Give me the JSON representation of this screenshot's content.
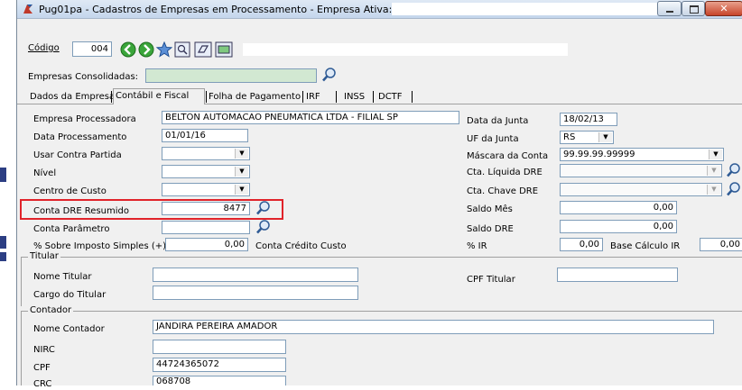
{
  "window": {
    "title": "Pug01pa - Cadastros de Empresas em Processamento - Empresa Ativa:"
  },
  "header": {
    "codigo_label": "Código",
    "codigo_value": "004",
    "consolidadas_label": "Empresas Consolidadas:",
    "consolidadas_value": ""
  },
  "tabs": [
    {
      "label": "Dados da Empresa"
    },
    {
      "label": "Contábil e Fiscal"
    },
    {
      "label": "Folha de Pagamento"
    },
    {
      "label": "IRF"
    },
    {
      "label": "INSS"
    },
    {
      "label": "DCTF"
    }
  ],
  "active_tab": "Contábil e Fiscal",
  "left_fields": {
    "empresa_processadora": {
      "label": "Empresa Processadora",
      "value": "BELTON AUTOMACAO PNEUMATICA LTDA - FILIAL SP"
    },
    "data_processamento": {
      "label": "Data Processamento",
      "value": "01/01/16"
    },
    "usar_contra_partida": {
      "label": "Usar Contra Partida",
      "value": ""
    },
    "nivel": {
      "label": "Nível",
      "value": ""
    },
    "centro_custo": {
      "label": "Centro de Custo",
      "value": ""
    },
    "conta_dre_resumido": {
      "label": "Conta DRE Resumido",
      "value": "8477"
    },
    "conta_parametro": {
      "label": "Conta Parâmetro",
      "value": ""
    },
    "sobre_imposto": {
      "label": "% Sobre Imposto Simples (+)",
      "value": "0,00"
    },
    "conta_credito_custo": {
      "label": "Conta Crédito Custo"
    }
  },
  "right_fields": {
    "data_junta": {
      "label": "Data da Junta",
      "value": "18/02/13"
    },
    "uf_junta": {
      "label": "UF da Junta",
      "value": "RS"
    },
    "mascara_conta": {
      "label": "Máscara da Conta",
      "value": "99.99.99.99999"
    },
    "cta_liquida_dre": {
      "label": "Cta. Líquida DRE",
      "value": ""
    },
    "cta_chave_dre": {
      "label": "Cta. Chave DRE",
      "value": ""
    },
    "saldo_mes": {
      "label": "Saldo Mês",
      "value": "0,00"
    },
    "saldo_dre": {
      "label": "Saldo DRE",
      "value": "0,00"
    },
    "ir": {
      "label": "% IR",
      "value": "0,00"
    },
    "base_calculo_ir": {
      "label": "Base Cálculo IR",
      "value": "0,00"
    }
  },
  "titular": {
    "group_label": "Titular",
    "nome_label": "Nome Titular",
    "nome_value": "",
    "cargo_label": "Cargo do Titular",
    "cargo_value": "",
    "cpf_label": "CPF Titular",
    "cpf_value": ""
  },
  "contador": {
    "group_label": "Contador",
    "nome_label": "Nome Contador",
    "nome_value": "JANDIRA PEREIRA AMADOR",
    "nirc_label": "NIRC",
    "nirc_value": "",
    "cpf_label": "CPF",
    "cpf_value": "44724365072",
    "crc_label": "CRC",
    "crc_value": "068708"
  },
  "colors": {
    "highlight": "#e0232a",
    "input_border": "#7f9db9",
    "green_field": "#d2e8d2"
  }
}
